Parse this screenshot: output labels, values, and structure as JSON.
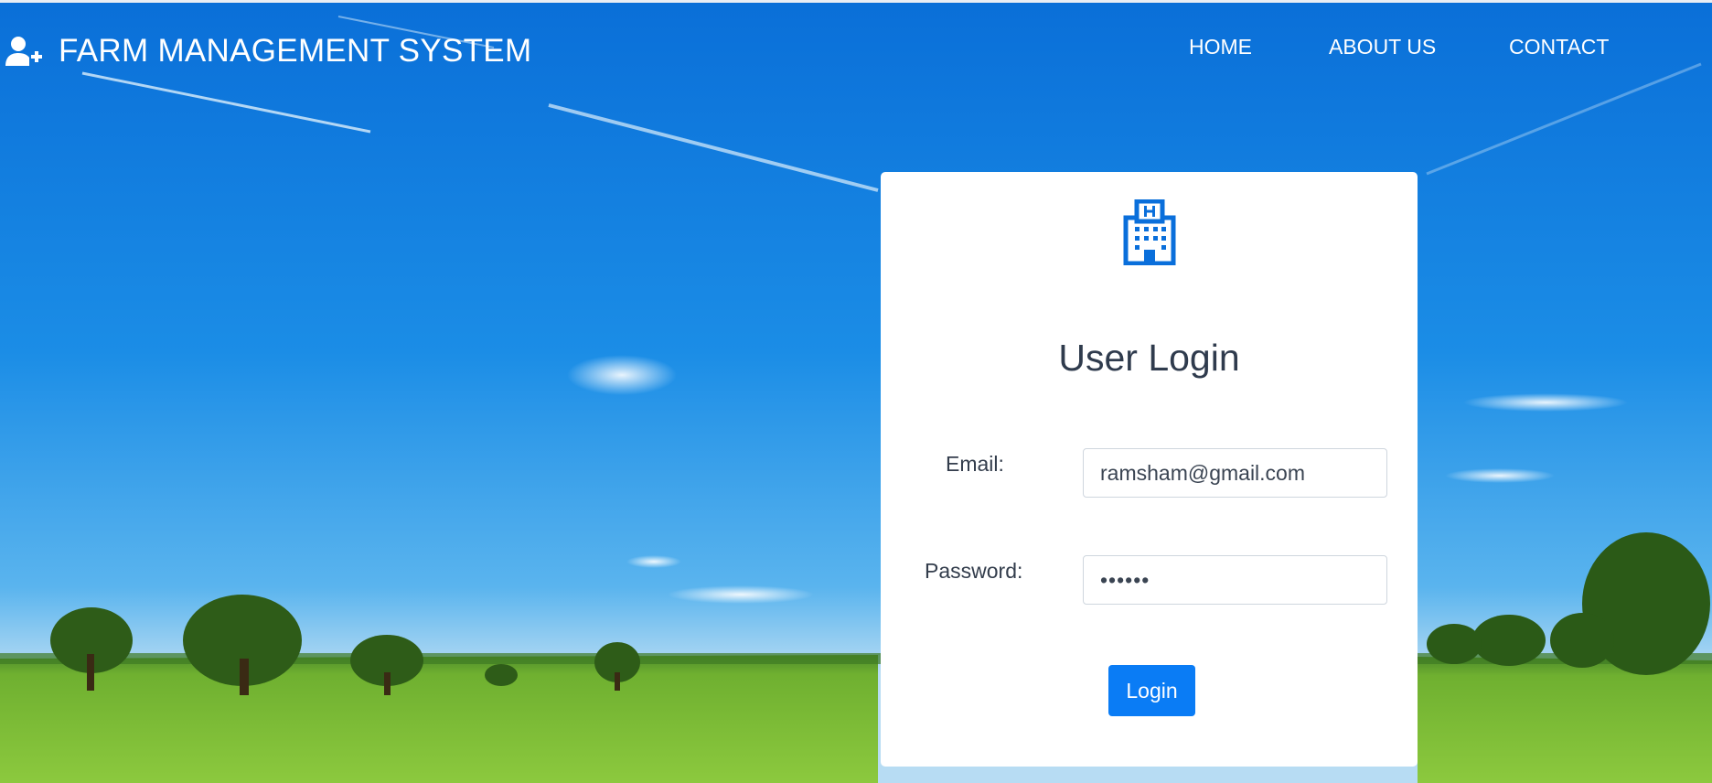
{
  "brand": {
    "title": "FARM MANAGEMENT SYSTEM",
    "icon": "user-plus-icon"
  },
  "nav": {
    "items": [
      "HOME",
      "ABOUT US",
      "CONTACT"
    ]
  },
  "login_card": {
    "icon": "hospital-building-icon",
    "title": "User Login",
    "email_label": "Email:",
    "email_value": "ramsham@gmail.com",
    "password_label": "Password:",
    "password_value": "••••••",
    "button_label": "Login"
  },
  "colors": {
    "accent": "#0a7cf5",
    "title_text": "#2f3b4d",
    "sky": "#0b74d6",
    "grass": "#7fc23b"
  }
}
